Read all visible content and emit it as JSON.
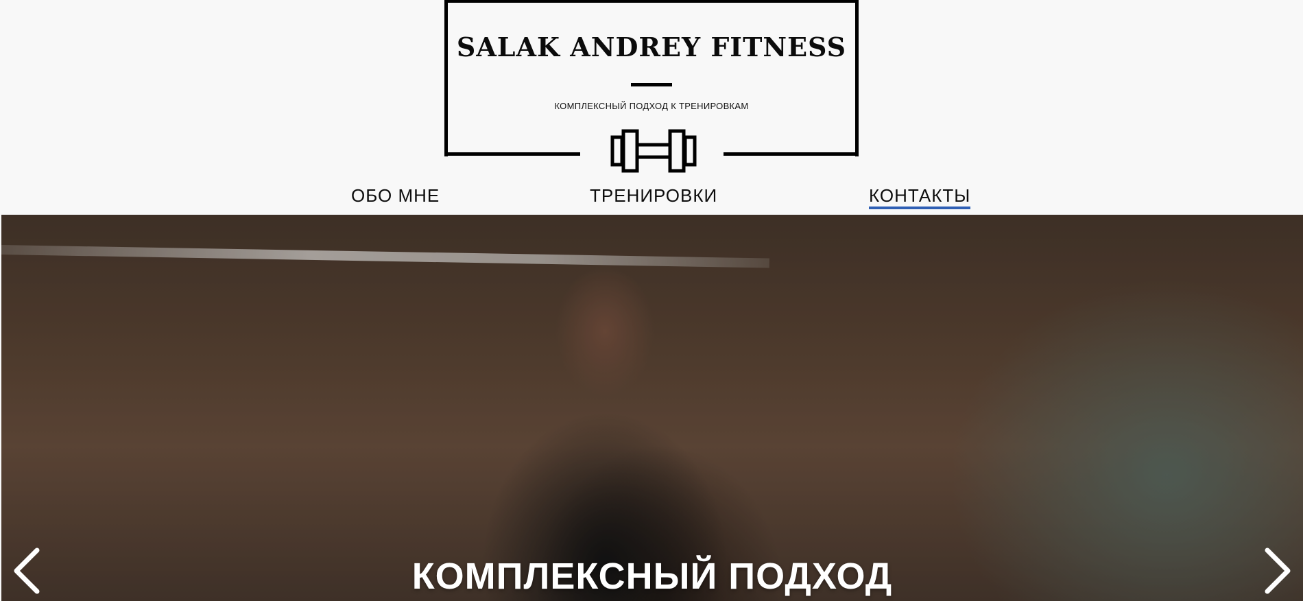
{
  "header": {
    "title": "SALAK ANDREY FITNESS",
    "tagline": "КОМПЛЕКСНЫЙ ПОДХОД К ТРЕНИРОВКАМ",
    "logo_icon": "dumbbell-icon"
  },
  "nav": {
    "items": [
      {
        "label": "ОБО МНЕ",
        "active": false
      },
      {
        "label": "ТРЕНИРОВКИ",
        "active": false
      },
      {
        "label": "КОНТАКТЫ",
        "active": true
      }
    ],
    "active_underline_color": "#2f5fb4"
  },
  "hero": {
    "heading": "КОМПЛЕКСНЫЙ ПОДХОД",
    "prev_icon": "chevron-left-icon",
    "next_icon": "chevron-right-icon"
  },
  "colors": {
    "background": "#f8f8f8",
    "text": "#000000",
    "accent": "#2f5fb4"
  }
}
